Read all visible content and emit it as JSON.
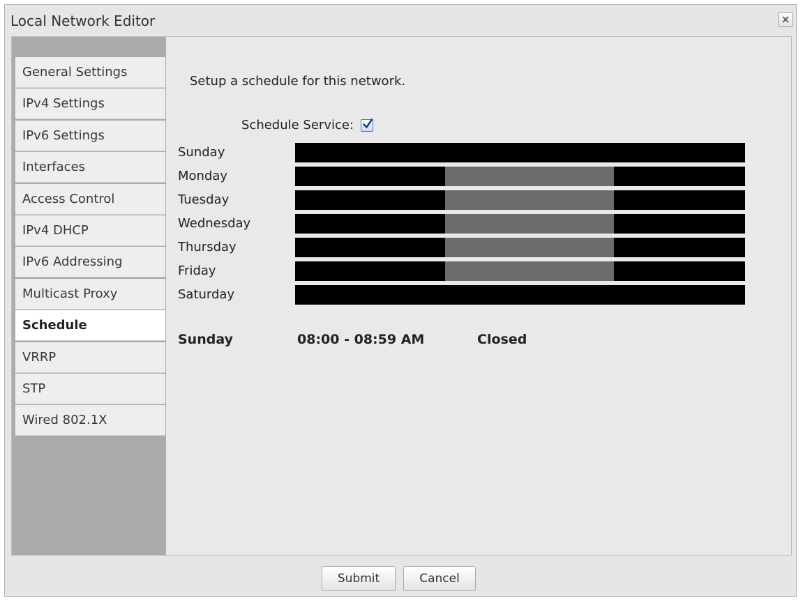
{
  "window": {
    "title": "Local Network Editor",
    "close_icon": "close-icon"
  },
  "sidebar": {
    "items": [
      {
        "label": "General Settings"
      },
      {
        "label": "IPv4 Settings"
      },
      {
        "label": "IPv6 Settings"
      },
      {
        "label": "Interfaces"
      },
      {
        "label": "Access Control"
      },
      {
        "label": "IPv4 DHCP"
      },
      {
        "label": "IPv6 Addressing"
      },
      {
        "label": "Multicast Proxy"
      },
      {
        "label": "Schedule",
        "active": true
      },
      {
        "label": "VRRP"
      },
      {
        "label": "STP"
      },
      {
        "label": "Wired 802.1X"
      }
    ]
  },
  "schedule": {
    "intro": "Setup a schedule for this network.",
    "service_label": "Schedule Service:",
    "service_enabled": true,
    "days": [
      {
        "label": "Sunday",
        "open_from_hour": null,
        "open_to_hour": null
      },
      {
        "label": "Monday",
        "open_from_hour": 8,
        "open_to_hour": 17
      },
      {
        "label": "Tuesday",
        "open_from_hour": 8,
        "open_to_hour": 17
      },
      {
        "label": "Wednesday",
        "open_from_hour": 8,
        "open_to_hour": 17
      },
      {
        "label": "Thursday",
        "open_from_hour": 8,
        "open_to_hour": 17
      },
      {
        "label": "Friday",
        "open_from_hour": 8,
        "open_to_hour": 17
      },
      {
        "label": "Saturday",
        "open_from_hour": null,
        "open_to_hour": null
      }
    ],
    "selected": {
      "day": "Sunday",
      "time": "08:00 - 08:59 AM",
      "status": "Closed"
    },
    "colors": {
      "closed": "#000000",
      "open": "#6b6b6b"
    }
  },
  "footer": {
    "submit_label": "Submit",
    "cancel_label": "Cancel"
  }
}
